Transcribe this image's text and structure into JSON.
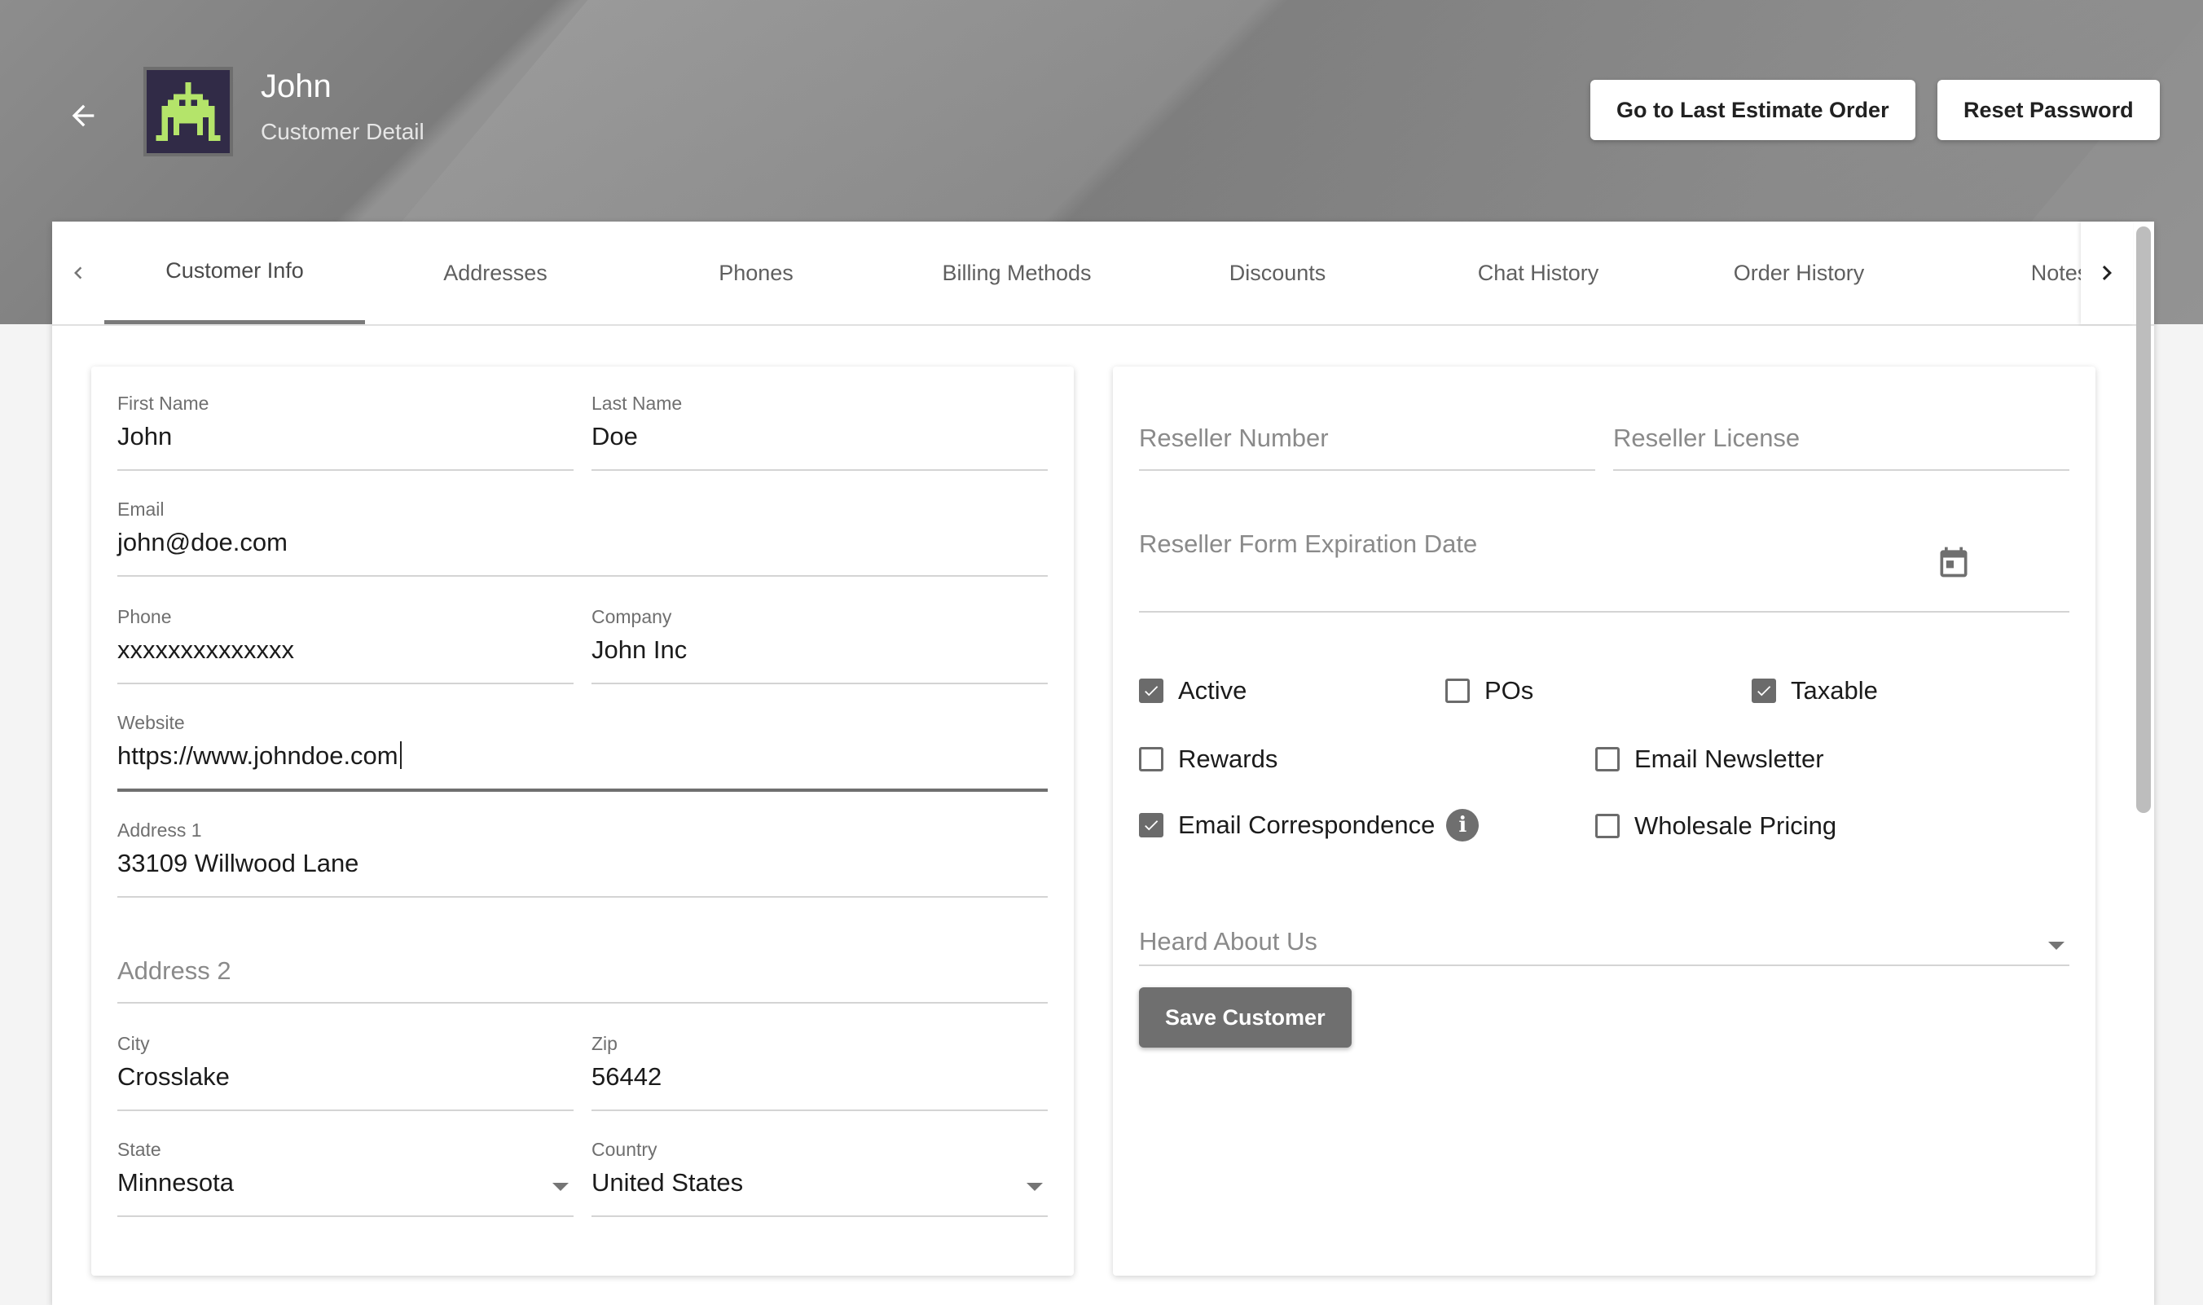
{
  "header": {
    "title": "John",
    "subtitle": "Customer Detail",
    "last_estimate_label": "Go to Last Estimate Order",
    "reset_password_label": "Reset Password"
  },
  "tabs": [
    {
      "label": "Customer Info",
      "active": true
    },
    {
      "label": "Addresses"
    },
    {
      "label": "Phones"
    },
    {
      "label": "Billing Methods"
    },
    {
      "label": "Discounts"
    },
    {
      "label": "Chat History"
    },
    {
      "label": "Order History"
    },
    {
      "label": "Notes"
    }
  ],
  "customer_form": {
    "first_name": {
      "label": "First Name",
      "value": "John"
    },
    "last_name": {
      "label": "Last Name",
      "value": "Doe"
    },
    "email": {
      "label": "Email",
      "value": "john@doe.com"
    },
    "phone": {
      "label": "Phone",
      "value": "xxxxxxxxxxxxxx"
    },
    "company": {
      "label": "Company",
      "value": "John Inc"
    },
    "website": {
      "label": "Website",
      "value": "https://www.johndoe.com"
    },
    "address1": {
      "label": "Address 1",
      "value": "33109 Willwood Lane"
    },
    "address2": {
      "placeholder": "Address 2",
      "value": ""
    },
    "city": {
      "label": "City",
      "value": "Crosslake"
    },
    "zip": {
      "label": "Zip",
      "value": "56442"
    },
    "state": {
      "label": "State",
      "value": "Minnesota"
    },
    "country": {
      "label": "Country",
      "value": "United States"
    }
  },
  "reseller": {
    "number_placeholder": "Reseller Number",
    "license_placeholder": "Reseller License",
    "expiration_placeholder": "Reseller Form Expiration Date"
  },
  "flags": {
    "active": {
      "label": "Active",
      "checked": true
    },
    "pos": {
      "label": "POs",
      "checked": false
    },
    "taxable": {
      "label": "Taxable",
      "checked": true
    },
    "rewards": {
      "label": "Rewards",
      "checked": false
    },
    "email_newsletter": {
      "label": "Email Newsletter",
      "checked": false
    },
    "email_correspondence": {
      "label": "Email Correspondence",
      "checked": true
    },
    "wholesale_pricing": {
      "label": "Wholesale Pricing",
      "checked": false
    }
  },
  "heard_about_us": {
    "placeholder": "Heard About Us"
  },
  "save_label": "Save Customer",
  "icons": {
    "back": "arrow-left-icon",
    "prev_tab": "chevron-left-icon",
    "next_tab": "chevron-right-icon",
    "calendar": "calendar-icon",
    "info": "info-icon",
    "dropdown": "caret-down-icon"
  },
  "colors": {
    "header_bg": "#888888",
    "avatar_bg": "#312b47",
    "avatar_sprite": "#b4e46a",
    "accent": "#6f6f6f"
  }
}
